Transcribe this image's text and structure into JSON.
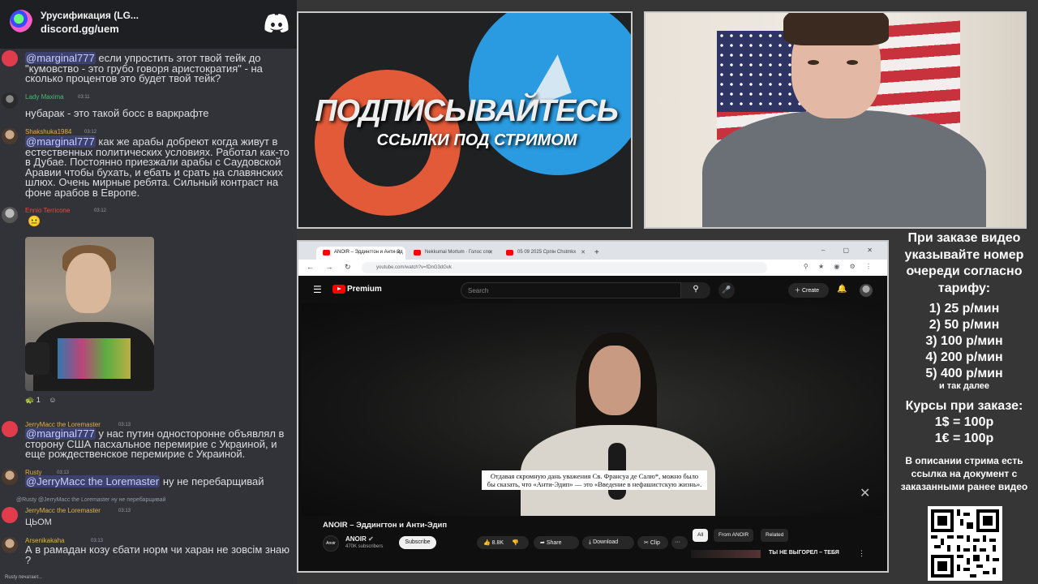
{
  "discord": {
    "server_name": "Урусификация (LG...",
    "invite": "discord.gg/uem",
    "messages": [
      {
        "author": "",
        "time": "",
        "text_mention": "@marginal777",
        "text": " если упростить этот твой тейк до \"кумовство - это грубо говоря аристократия\" - на сколько процентов это будет твой тейк?"
      },
      {
        "author": "Lady Maxima",
        "time": "03:11",
        "text": "нубарак - это такой босс в варкрафте"
      },
      {
        "author": "Shakshuka1984",
        "time": "03:12",
        "text_mention": "@marginal777",
        "text": " как же арабы добреют когда живут в естественных политических условиях. Работал как-то в Дубае. Постоянно приезжали арабы с Саудовской Аравии чтобы бухать, и ебать и срать на славянских шлюх. Очень мирные ребята. Сильный контраст на фоне арабов в Европе."
      },
      {
        "author": "Ennio Terricone",
        "time": "03:12",
        "text": ""
      },
      {
        "author": "JerryMacc the Loremaster",
        "time": "03:13",
        "text_mention": "@marginal777",
        "text": " у нас путин односторонне объявлял в сторону США пасхальное перемирие с Украиной, и еще рождественское перемирие с Украиной."
      },
      {
        "author": "Rusty",
        "time": "03:13",
        "text_mention": "@JerryMacc the Loremaster",
        "text": " ну не перебарщивай"
      },
      {
        "author": "JerryMacc the Loremaster",
        "time": "03:13",
        "reply": "@Rusty @JerryMacc the Loremaster ну не перебарщивай",
        "text": "ЦЬОМ"
      },
      {
        "author": "Arsenikakaha",
        "time": "03:13",
        "text": "А в рамадан козу єбати норм чи харан не зовсім знаю ?"
      }
    ],
    "reaction_count": "1",
    "typing": "Rusty печатает..."
  },
  "promo": {
    "line1": "ПОДПИСЫВАЙТЕСЬ",
    "line2": "ССЫЛКИ ПОД СТРИМОМ"
  },
  "browser": {
    "tabs": [
      {
        "label": "ANOIR – Эддингтон и Анти-Эд"
      },
      {
        "label": "Nekkumai Mortum · Голос спо"
      },
      {
        "label": "05 09 2025 Српін Сhstmkx"
      }
    ],
    "url": "youtube.com/watch?v=fDnG3dGvk"
  },
  "youtube": {
    "logo_text": "Premium",
    "search_placeholder": "Search",
    "create_label": "Create",
    "subtitle": "Отдавая скромную дань уважения Св. Франсуа де Салю*, можно было бы сказать, что «Анти-Эдип» — это «Введение в нефашистскую жизнь».",
    "video_title": "ANOIR – Эддингтон и Анти-Эдип",
    "channel_avatar_text": "Anoir",
    "channel_name": "ANOIR",
    "subscribers": "470K subscribers",
    "subscribe_label": "Subscribe",
    "likes": "8.8K",
    "share_label": "Share",
    "download_label": "Download",
    "clip_label": "Clip",
    "more_label": "···",
    "chips": [
      "All",
      "From ANOIR",
      "Related"
    ],
    "rec_title": "ТЫ НЕ ВЫГОРЕЛ – ТЕБЯ"
  },
  "prices": {
    "heading": "При заказе видео указывайте номер очереди согласно тарифу:",
    "tiers": [
      "1) 25 р/мин",
      "2) 50 р/мин",
      "3) 100 р/мин",
      "4) 200 р/мин",
      "5) 400 р/мин"
    ],
    "etc": "и так далее",
    "rates_title": "Курсы при заказе:",
    "rate_usd": "1$ = 100р",
    "rate_eur": "1€ = 100р",
    "description_note": "В описании стрима есть ссылка на документ с заказанными ранее видео"
  },
  "colors": {
    "discord_bg": "#313338",
    "mention_bg": "#3c4270",
    "youtube_red": "#ff0000",
    "telegram_blue": "#2a9be0",
    "patreon_orange": "#e35a38"
  }
}
